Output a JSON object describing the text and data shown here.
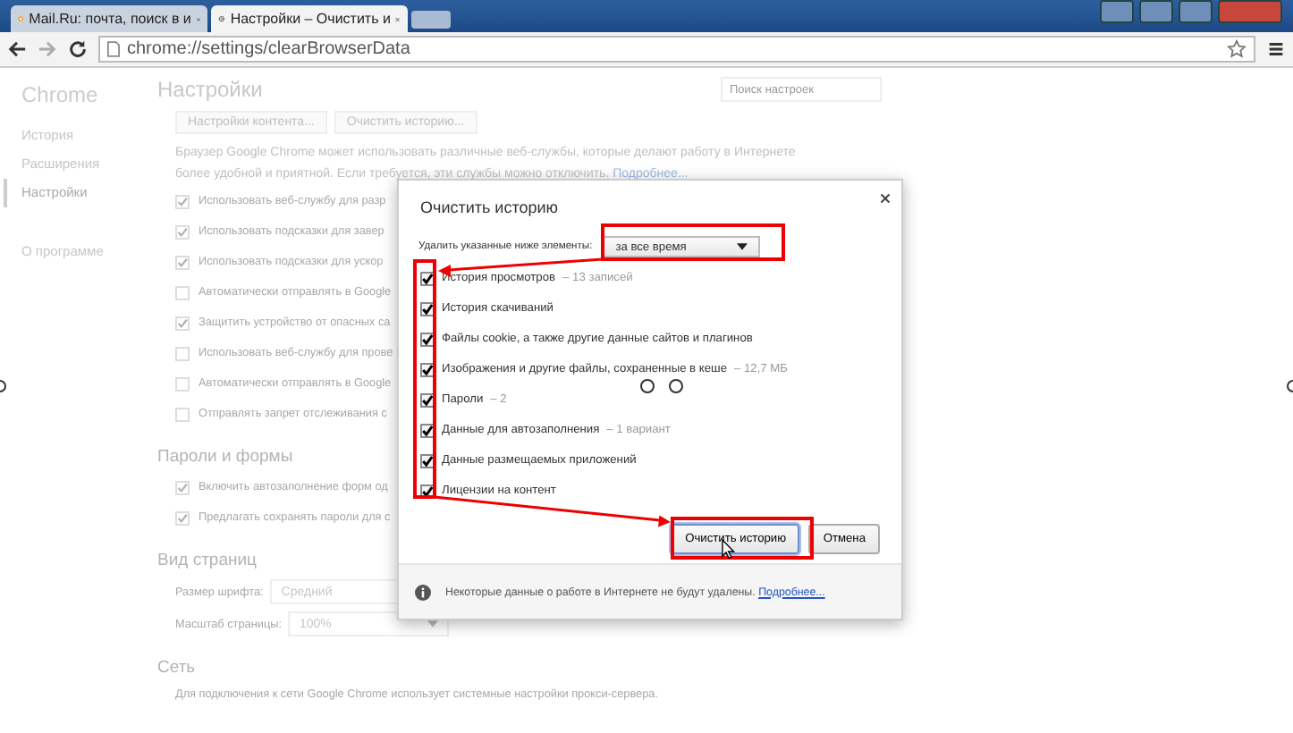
{
  "browser": {
    "tabs": [
      {
        "title": "Mail.Ru: почта, поиск в и",
        "selected": false
      },
      {
        "title": "Настройки – Очистить и",
        "selected": true
      }
    ],
    "address": "chrome://settings/clearBrowserData"
  },
  "sidebar": {
    "title": "Chrome",
    "items": [
      {
        "label": "История",
        "selected": false
      },
      {
        "label": "Расширения",
        "selected": false
      },
      {
        "label": "Настройки",
        "selected": true
      }
    ],
    "about": "О программе"
  },
  "settings": {
    "heading": "Настройки",
    "search": {
      "placeholder": "Поиск настроек"
    },
    "top_buttons": [
      "Настройки контента...",
      "Очистить историю..."
    ],
    "intro": {
      "text": "Браузер Google Chrome может использовать различные веб-службы, которые делают работу в Интернете более удобной и приятной. Если требуется, эти службы можно отключить.",
      "link": "Подробнее..."
    },
    "privacy_options": [
      {
        "label": "Использовать веб-службу для разр",
        "checked": true
      },
      {
        "label": "Использовать подсказки для завер",
        "checked": true
      },
      {
        "label": "Использовать подсказки для ускор",
        "checked": true
      },
      {
        "label": "Автоматически отправлять в Google",
        "checked": false
      },
      {
        "label": "Защитить устройство от опасных са",
        "checked": true
      },
      {
        "label": "Использовать веб-службу для прове",
        "checked": false
      },
      {
        "label": "Автоматически отправлять в Google",
        "checked": false
      },
      {
        "label": "Отправлять запрет отслеживания с",
        "checked": false
      }
    ],
    "sections": [
      {
        "kind": "options",
        "title": "Пароли и формы",
        "options": [
          {
            "label": "Включить автозаполнение форм од",
            "checked": true
          },
          {
            "label": "Предлагать сохранять пароли для с",
            "checked": true
          }
        ]
      },
      {
        "kind": "selects",
        "title": "Вид страниц",
        "fields": [
          {
            "label": "Размер шрифта:",
            "value": "Средний"
          },
          {
            "label": "Масштаб страницы:",
            "value": "100%"
          }
        ]
      },
      {
        "kind": "text",
        "title": "Сеть",
        "text": "Для подключения к сети Google Chrome использует системные настройки прокси-сервера."
      }
    ]
  },
  "dialog": {
    "title": "Очистить историю",
    "period_label": "Удалить указанные ниже элементы:",
    "period": "за все время",
    "items": [
      {
        "label": "История просмотров",
        "detail": "– 13 записей",
        "checked": true
      },
      {
        "label": "История скачиваний",
        "checked": true
      },
      {
        "label": "Файлы cookie, а также другие данные сайтов и плагинов",
        "checked": true
      },
      {
        "label": "Изображения и другие файлы, сохраненные в кеше",
        "detail": "– 12,7 МБ",
        "checked": true
      },
      {
        "label": "Пароли",
        "detail": "– 2",
        "checked": true
      },
      {
        "label": "Данные для автозаполнения",
        "detail": "– 1 вариант",
        "checked": true
      },
      {
        "label": "Данные размещаемых приложений",
        "checked": true
      },
      {
        "label": "Лицензии на контент",
        "checked": true
      }
    ],
    "buttons": [
      "Очистить историю",
      "Отмена"
    ],
    "footer": {
      "text": "Некоторые данные о работе в Интернете не будут удалены.",
      "link": "Подробнее..."
    }
  }
}
